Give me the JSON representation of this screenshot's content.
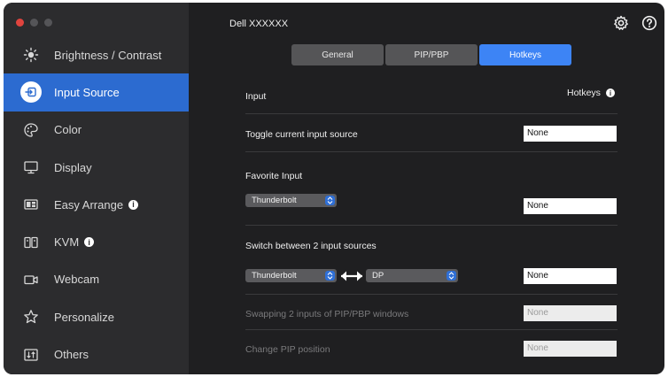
{
  "app": {
    "title": "Dell XXXXXX"
  },
  "sidebar": {
    "items": [
      {
        "label": "Brightness / Contrast",
        "icon": "sun-icon"
      },
      {
        "label": "Input Source",
        "icon": "input-source-icon",
        "active": true
      },
      {
        "label": "Color",
        "icon": "palette-icon"
      },
      {
        "label": "Display",
        "icon": "monitor-icon"
      },
      {
        "label": "Easy Arrange",
        "icon": "layout-icon",
        "info": true
      },
      {
        "label": "KVM",
        "icon": "kvm-icon",
        "info": true
      },
      {
        "label": "Webcam",
        "icon": "webcam-icon"
      },
      {
        "label": "Personalize",
        "icon": "star-icon"
      },
      {
        "label": "Others",
        "icon": "others-icon"
      }
    ]
  },
  "tabs": [
    {
      "label": "General"
    },
    {
      "label": "PIP/PBP"
    },
    {
      "label": "Hotkeys",
      "active": true
    }
  ],
  "content": {
    "input_header": "Input",
    "hotkeys_header": "Hotkeys",
    "toggle_label": "Toggle current input source",
    "toggle_hotkey": "None",
    "favorite_label": "Favorite Input",
    "favorite_select": "Thunderbolt",
    "favorite_hotkey": "None",
    "switch_label": "Switch between 2 input sources",
    "switch_select_a": "Thunderbolt",
    "switch_select_b": "DP",
    "switch_hotkey": "None",
    "swap_label": "Swapping 2 inputs of PIP/PBP windows",
    "swap_hotkey": "None",
    "pip_label": "Change PIP position",
    "pip_hotkey": "None"
  },
  "colors": {
    "accent": "#3d84f5",
    "sidebar_active": "#2c6bd0",
    "window_bg": "#1f1f21",
    "sidebar_bg": "#2c2c2e"
  }
}
